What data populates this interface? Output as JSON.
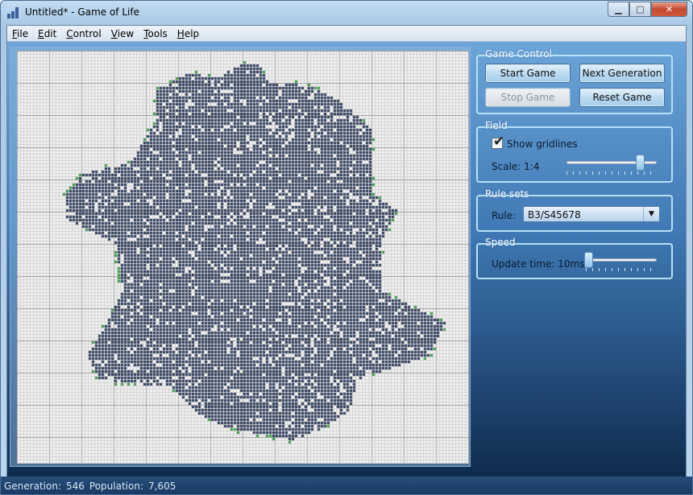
{
  "window": {
    "title": "Untitled* - Game of Life",
    "controls": {
      "minimize": "▁",
      "maximize": "□",
      "close": "✕"
    }
  },
  "menu": [
    {
      "accel": "F",
      "rest": "ile"
    },
    {
      "accel": "E",
      "rest": "dit"
    },
    {
      "accel": "C",
      "rest": "ontrol"
    },
    {
      "accel": "V",
      "rest": "iew"
    },
    {
      "accel": "T",
      "rest": "ools"
    },
    {
      "accel": "H",
      "rest": "elp"
    }
  ],
  "game_control": {
    "title": "Game Control",
    "start": "Start Game",
    "next": "Next Generation",
    "stop": "Stop Game",
    "reset": "Reset Game"
  },
  "field": {
    "title": "Field",
    "show_gridlines": "Show gridlines",
    "gridlines_checked": true,
    "scale_label": "Scale: 1:4",
    "scale_fraction": 0.85
  },
  "rule_sets": {
    "title": "Rule sets",
    "rule_label": "Rule:",
    "rule_value": "B3/S45678"
  },
  "speed": {
    "title": "Speed",
    "update_label": "Update time: 10ms",
    "speed_fraction": 0.0
  },
  "status": {
    "generation_label": "Generation:",
    "generation": "546",
    "population_label": "Population:",
    "population": "7,605"
  },
  "colors": {
    "live": "#2b3b5c",
    "edge": "#3aa046",
    "grid": "#d0d0d0",
    "major": "#9a9a9a",
    "bg": "#f4f4f4"
  }
}
